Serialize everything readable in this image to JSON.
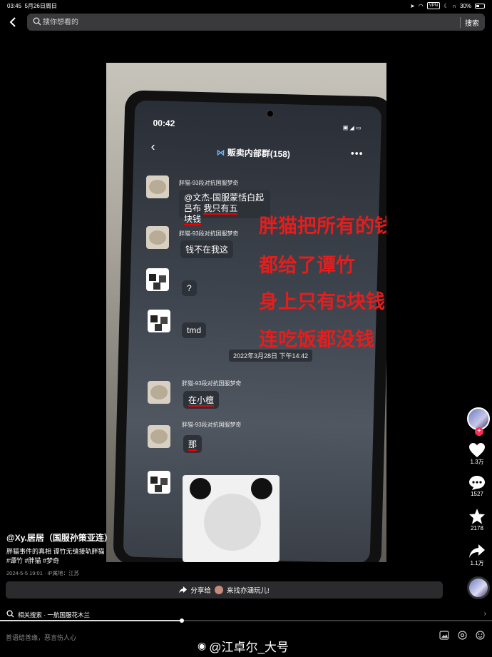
{
  "status_bar": {
    "time": "03:45",
    "date": "5月26日周日",
    "vpn": "VPN",
    "battery": "30%"
  },
  "search": {
    "placeholder": "搜你想看的",
    "button": "搜索"
  },
  "video": {
    "phone_time": "00:42",
    "chat_title": "贩卖内部群(158)",
    "messages": [
      {
        "nick": "胖猫-93段对抗国服梦奇",
        "text1": "@文杰-国服蒙恬白起吕布",
        "text1b": "我只有五",
        "text2": "块钱"
      },
      {
        "nick": "胖猫-93段对抗国服梦奇",
        "text": "钱不在我这"
      },
      {
        "text": "?"
      },
      {
        "text": "tmd"
      },
      {
        "nick": "胖猫-93段对抗国服梦奇",
        "text": "在小檀"
      },
      {
        "nick": "胖猫-93段对抗国服梦奇",
        "text": "那"
      }
    ],
    "date_chip": "2022年3月28日 下午14:42",
    "overlay_lines": [
      "胖猫把所有的钱",
      "都给了谭竹",
      "身上只有5块钱",
      "连吃饭都没钱"
    ]
  },
  "rail": {
    "likes": "1.3万",
    "comments": "1527",
    "favorites": "2178",
    "shares": "1.1万"
  },
  "post": {
    "author": "@Xy.居居（国服孙策亚连）",
    "caption": "胖猫事件的真相 谭竹无缝接轨胖猫",
    "tags": "#谭竹 #胖猫 #梦奇",
    "meta": "2024-5-5 19:01 · IP属地：江苏"
  },
  "share_bar": {
    "label": "分享给",
    "target": "来找亦涵玩儿!"
  },
  "related": {
    "label": "相关搜索 · 一航国服花木兰",
    "progress": 0.37
  },
  "comment_box": {
    "placeholder": "善语结善缘，恶言伤人心"
  },
  "watermark": "@江卓尔_大号"
}
